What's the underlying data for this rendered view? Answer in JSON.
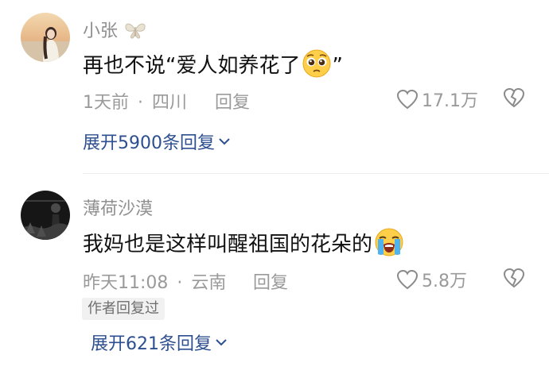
{
  "comments": [
    {
      "username": "小张",
      "content": "再也不说“爱人如养花了",
      "content_end": "”",
      "emoji": "pleading-face",
      "time": "1天前",
      "separator": "·",
      "location": "四川",
      "reply_label": "回复",
      "likes": "17.1万",
      "expand_label": "展开5900条回复"
    },
    {
      "username": "薄荷沙漠",
      "content": "我妈也是这样叫醒祖国的花朵的",
      "emoji": "loudly-crying-face",
      "time": "昨天11:08",
      "separator": "·",
      "location": "云南",
      "reply_label": "回复",
      "likes": "5.8万",
      "badge": "作者回复过",
      "expand_label": "展开621条回复"
    }
  ],
  "colors": {
    "link": "#2d4f8f",
    "meta": "#9a9a9a",
    "text": "#111111"
  }
}
